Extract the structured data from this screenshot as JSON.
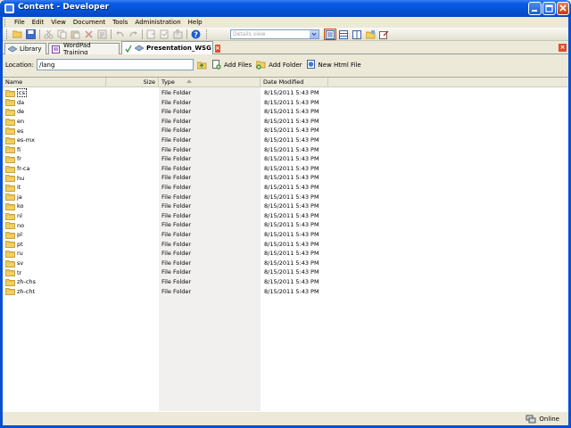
{
  "window": {
    "title": "Content - Developer"
  },
  "menu": [
    "File",
    "Edit",
    "View",
    "Document",
    "Tools",
    "Administration",
    "Help"
  ],
  "toolbar": {
    "view_placeholder": "Details view"
  },
  "tabs": [
    {
      "label": "Library"
    },
    {
      "label": "WordPad Training"
    },
    {
      "label": "Presentation_WSG"
    }
  ],
  "location": {
    "label": "Location:",
    "value": "/lang",
    "actions": {
      "add_files": "Add Files",
      "add_folder": "Add Folder",
      "new_html": "New Html File"
    }
  },
  "columns": {
    "name": "Name",
    "size": "Size",
    "type": "Type",
    "date": "Date Modified"
  },
  "rows": [
    {
      "name": "cs",
      "type": "File Folder",
      "date": "8/15/2011 5:43 PM"
    },
    {
      "name": "da",
      "type": "File Folder",
      "date": "8/15/2011 5:43 PM"
    },
    {
      "name": "de",
      "type": "File Folder",
      "date": "8/15/2011 5:43 PM"
    },
    {
      "name": "en",
      "type": "File Folder",
      "date": "8/15/2011 5:43 PM"
    },
    {
      "name": "es",
      "type": "File Folder",
      "date": "8/15/2011 5:43 PM"
    },
    {
      "name": "es-mx",
      "type": "File Folder",
      "date": "8/15/2011 5:43 PM"
    },
    {
      "name": "fi",
      "type": "File Folder",
      "date": "8/15/2011 5:43 PM"
    },
    {
      "name": "fr",
      "type": "File Folder",
      "date": "8/15/2011 5:43 PM"
    },
    {
      "name": "fr-ca",
      "type": "File Folder",
      "date": "8/15/2011 5:43 PM"
    },
    {
      "name": "hu",
      "type": "File Folder",
      "date": "8/15/2011 5:43 PM"
    },
    {
      "name": "it",
      "type": "File Folder",
      "date": "8/15/2011 5:43 PM"
    },
    {
      "name": "ja",
      "type": "File Folder",
      "date": "8/15/2011 5:43 PM"
    },
    {
      "name": "ko",
      "type": "File Folder",
      "date": "8/15/2011 5:43 PM"
    },
    {
      "name": "nl",
      "type": "File Folder",
      "date": "8/15/2011 5:43 PM"
    },
    {
      "name": "no",
      "type": "File Folder",
      "date": "8/15/2011 5:43 PM"
    },
    {
      "name": "pl",
      "type": "File Folder",
      "date": "8/15/2011 5:43 PM"
    },
    {
      "name": "pt",
      "type": "File Folder",
      "date": "8/15/2011 5:43 PM"
    },
    {
      "name": "ru",
      "type": "File Folder",
      "date": "8/15/2011 5:43 PM"
    },
    {
      "name": "sv",
      "type": "File Folder",
      "date": "8/15/2011 5:43 PM"
    },
    {
      "name": "tr",
      "type": "File Folder",
      "date": "8/15/2011 5:43 PM"
    },
    {
      "name": "zh-chs",
      "type": "File Folder",
      "date": "8/15/2011 5:43 PM"
    },
    {
      "name": "zh-cht",
      "type": "File Folder",
      "date": "8/15/2011 5:43 PM"
    }
  ],
  "status": {
    "connection": "Online"
  },
  "colors": {
    "titlebar": "#0552d6",
    "type_column_bg": "#f1f0ef",
    "folder": "#f3cf5f"
  }
}
